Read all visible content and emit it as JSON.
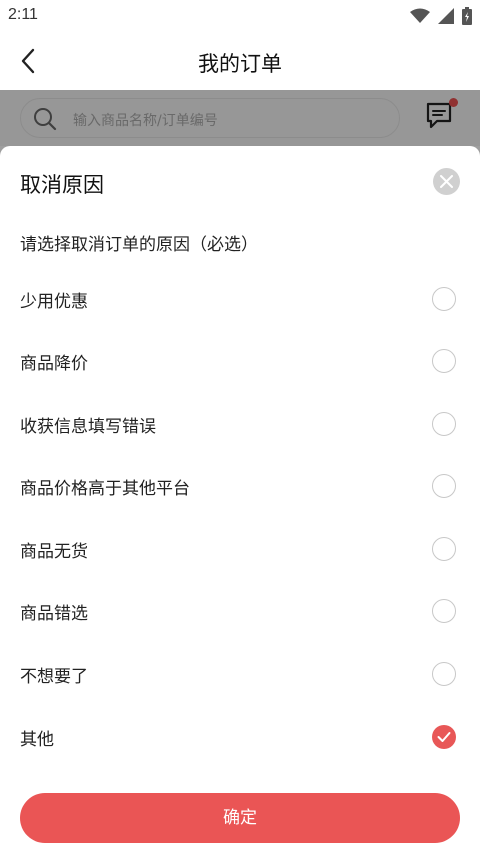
{
  "status_bar": {
    "time": "2:11",
    "icons": [
      "wifi-icon",
      "signal-icon",
      "battery-icon"
    ]
  },
  "header": {
    "back_icon": "chevron-left-icon",
    "title": "我的订单"
  },
  "search": {
    "placeholder": "输入商品名称/订单编号",
    "message_icon": "message-icon",
    "has_notification_dot": true
  },
  "sheet": {
    "title": "取消原因",
    "close_icon": "close-icon",
    "subtitle": "请选择取消订单的原因（必选）",
    "reasons": [
      {
        "label": "少用优惠",
        "selected": false
      },
      {
        "label": "商品降价",
        "selected": false
      },
      {
        "label": "收获信息填写错误",
        "selected": false
      },
      {
        "label": "商品价格高于其他平台",
        "selected": false
      },
      {
        "label": "商品无货",
        "selected": false
      },
      {
        "label": "商品错选",
        "selected": false
      },
      {
        "label": "不想要了",
        "selected": false
      },
      {
        "label": "其他",
        "selected": true
      }
    ],
    "confirm_label": "确定"
  },
  "colors": {
    "accent": "#ea5555",
    "overlay": "rgba(0,0,0,0.38)",
    "radio_border": "#c8c8c8"
  }
}
